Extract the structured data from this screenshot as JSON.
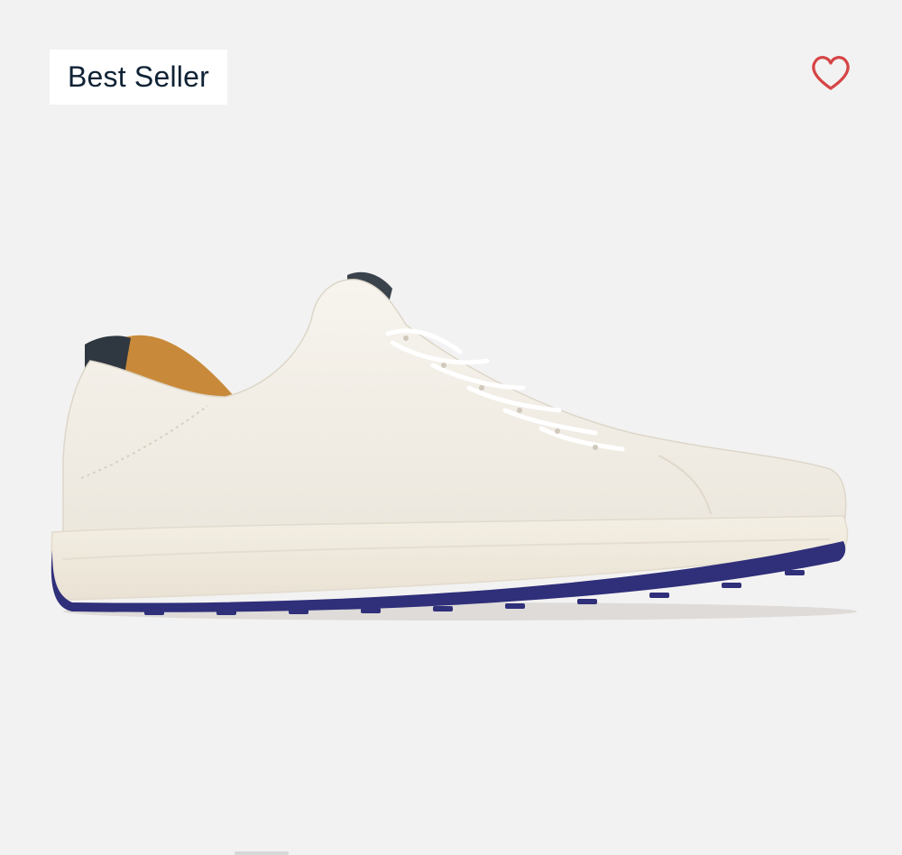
{
  "product_card": {
    "badge_label": "Best Seller",
    "favorite_icon": "heart-outline-icon",
    "image_subject": "white-leather-sneaker",
    "colors": {
      "background": "#f3f2f2",
      "badge_text": "#0f2235",
      "heart": "#d64545",
      "outsole_accent": "#2f2f7a",
      "heel_tab": "#2f3740",
      "lining": "#c88a3a"
    }
  }
}
